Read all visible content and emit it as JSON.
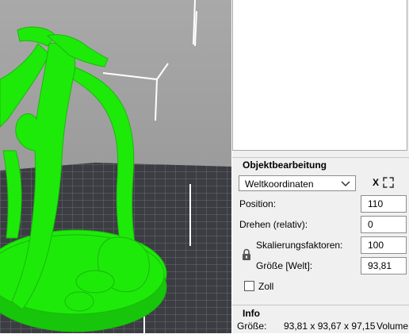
{
  "panel": {
    "object_edit": {
      "title": "Objektbearbeitung",
      "coordinate_system": "Weltkoordinaten",
      "reset_label": "X",
      "rows": {
        "position": {
          "label": "Position:",
          "value": "110"
        },
        "rotation": {
          "label": "Drehen (relativ):",
          "value": "0"
        },
        "scale": {
          "label": "Skalierungsfaktoren:",
          "value": "100"
        },
        "size": {
          "label": "Größe [Welt]:",
          "value": "93,81"
        }
      },
      "inches": {
        "label": "Zoll",
        "checked": false
      }
    },
    "info": {
      "title": "Info",
      "size_label": "Größe:",
      "size_value": "93,81 x 93,67 x 97,15",
      "volume_label": "Volume"
    }
  },
  "icons": {
    "dropdown": "chevron-down-icon",
    "lock_axes": "lock-axes-icon",
    "scale_lock": "padlock-icon"
  },
  "colors": {
    "model": "#1eea0a",
    "bed_grid": "#33353b",
    "viewport_bg": "#9c9c9c",
    "axis_lines": "#ffffff"
  }
}
